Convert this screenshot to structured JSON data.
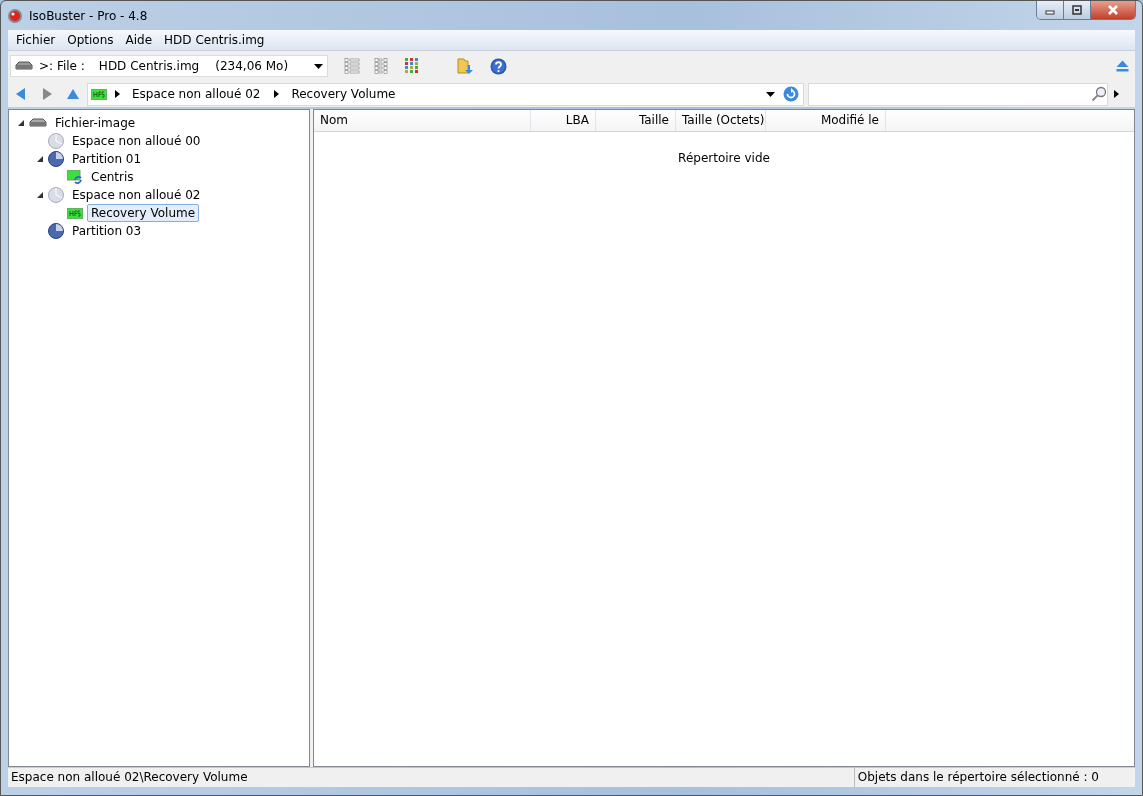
{
  "window": {
    "title": "IsoBuster - Pro - 4.8"
  },
  "menu": [
    "Fichier",
    "Options",
    "Aide",
    "HDD Centris.img"
  ],
  "file_selector": {
    "prefix": ">: File :",
    "name": "HDD Centris.img",
    "size": "(234,06 Mo)"
  },
  "address": {
    "path": [
      {
        "label": "Espace non alloué 02"
      },
      {
        "label": "Recovery Volume"
      }
    ]
  },
  "tree": [
    {
      "label": "Fichier-image",
      "kind": "drive",
      "expanded": true,
      "selected": false,
      "children": [
        {
          "label": "Espace non alloué 00",
          "kind": "unallocated",
          "selected": false
        },
        {
          "label": "Partition 01",
          "kind": "partition",
          "expanded": true,
          "selected": false,
          "children": [
            {
              "label": "Centris",
              "kind": "hfs-sync",
              "selected": false
            }
          ]
        },
        {
          "label": "Espace non alloué 02",
          "kind": "unallocated",
          "expanded": true,
          "selected": false,
          "children": [
            {
              "label": "Recovery Volume",
              "kind": "hfs",
              "selected": true
            }
          ]
        },
        {
          "label": "Partition 03",
          "kind": "partition",
          "selected": false
        }
      ]
    }
  ],
  "table": {
    "columns": [
      {
        "label": "Nom"
      },
      {
        "label": "LBA"
      },
      {
        "label": "Taille"
      },
      {
        "label": "Taille (Octets)"
      },
      {
        "label": "Modifié le"
      }
    ],
    "empty_message": "Répertoire vide"
  },
  "status_bar": {
    "path": "Espace non alloué 02\\Recovery Volume",
    "count": "Objets dans le répertoire sélectionné : 0"
  }
}
